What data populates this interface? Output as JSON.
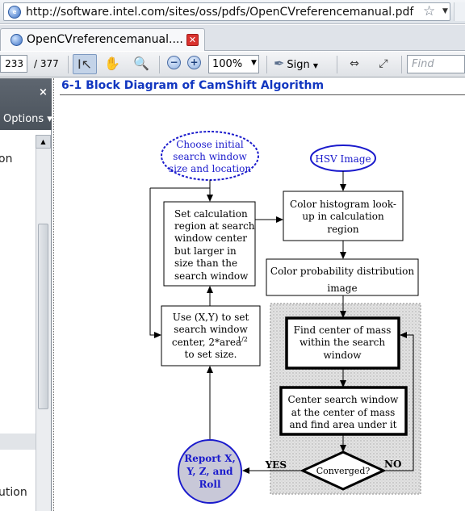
{
  "address_bar": {
    "url": "http://software.intel.com/sites/oss/pdfs/OpenCVreferencemanual.pdf"
  },
  "tab": {
    "label": "OpenCVreferencemanual....",
    "close": "✕"
  },
  "toolbar": {
    "page_number": "233",
    "page_total": "/ 377",
    "zoom": "100%",
    "sign": "Sign",
    "find_placeholder": "Find"
  },
  "left_panel": {
    "close": "×",
    "options": "Options ▾",
    "item1": "on",
    "item2": "ution"
  },
  "document": {
    "heading": "6-1  Block Diagram of CamShift Algorithm"
  },
  "diagram": {
    "choose": [
      "Choose initial",
      "search window",
      "size and location"
    ],
    "hsv": "HSV Image",
    "set_calc": [
      "Set calculation",
      "region at search",
      "window center",
      "but larger in",
      "size than the",
      "search window"
    ],
    "color_hist": [
      "Color histogram look-",
      "up in calculation",
      "region"
    ],
    "color_prob": [
      "Color probability distribution",
      "image"
    ],
    "use_xy": [
      "Use (X,Y) to set",
      "search window",
      "center, 2*area",
      "to set size."
    ],
    "use_xy_sup": "1/2",
    "find_mass": [
      "Find center of mass",
      "within the search",
      "window"
    ],
    "center_win": [
      "Center search window",
      "at the center of mass",
      "and find area under it"
    ],
    "report": [
      "Report X,",
      "Y, Z, and",
      "Roll"
    ],
    "converged": "Converged?",
    "yes": "YES",
    "no": "NO"
  },
  "colors": {
    "heading_blue": "#1237c0",
    "report_fill": "#c8c8d8",
    "ellipse_blue": "#1a1acc"
  }
}
